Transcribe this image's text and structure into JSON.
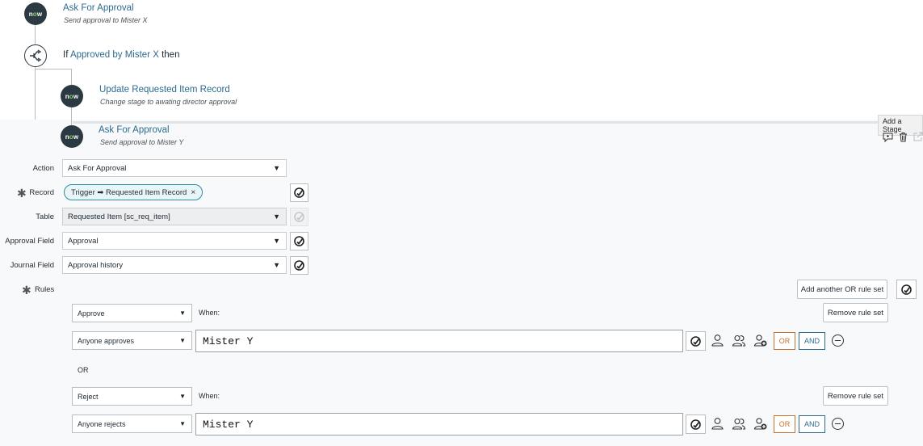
{
  "steps": [
    {
      "node": "now",
      "title": "Ask For Approval",
      "subtitle": "Send approval to Mister X"
    },
    {
      "node": "now",
      "title": "Update Requested Item Record",
      "subtitle": "Change stage to awating director approval"
    },
    {
      "node": "now",
      "title": "Ask For Approval",
      "subtitle": "Send approval to Mister Y"
    }
  ],
  "condition": {
    "prefix": "If",
    "link": "Approved by Mister X",
    "suffix": "then"
  },
  "tooltip": "Add a Stage",
  "form": {
    "action": {
      "label": "Action",
      "value": "Ask For Approval"
    },
    "record": {
      "label": "Record",
      "pill": "Trigger ➡ Requested Item Record",
      "pill_remove": "×"
    },
    "table": {
      "label": "Table",
      "value": "Requested Item [sc_req_item]"
    },
    "approval_field": {
      "label": "Approval Field",
      "value": "Approval"
    },
    "journal_field": {
      "label": "Journal Field",
      "value": "Approval history"
    },
    "rules": {
      "label": "Rules",
      "add_or_label": "Add another OR rule set"
    },
    "required_mark": "✱",
    "dropdown_arrow": "▼"
  },
  "rule_sets": [
    {
      "action": "Approve",
      "when_label": "When:",
      "remove_label": "Remove rule set",
      "condition": "Anyone approves",
      "value": "Mister Y",
      "or_label": "OR",
      "and_label": "AND"
    },
    {
      "action": "Reject",
      "when_label": "When:",
      "remove_label": "Remove rule set",
      "condition": "Anyone rejects",
      "value": "Mister Y",
      "or_label": "OR",
      "and_label": "AND"
    }
  ],
  "or_separator": "OR",
  "colors": {
    "accent": "#2c6b8f",
    "or": "#c8702e",
    "node": "#2b3a42",
    "now_o": "#7fd46b"
  }
}
